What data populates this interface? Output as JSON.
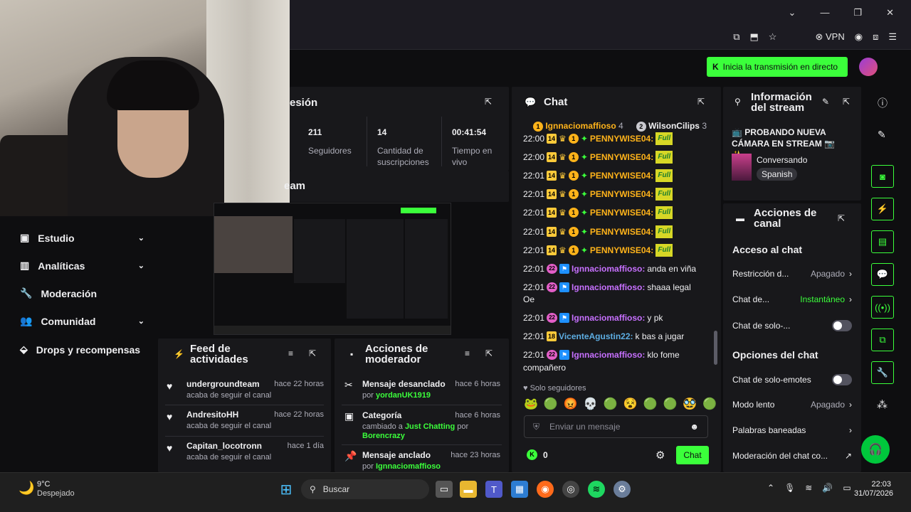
{
  "browser": {
    "vpn_label": "VPN"
  },
  "header": {
    "go_live": "Inicia la transmisión en directo"
  },
  "nav": [
    {
      "label": "Estudio",
      "expand": true
    },
    {
      "label": "Analíticas",
      "expand": true
    },
    {
      "label": "Moderación",
      "expand": false
    },
    {
      "label": "Comunidad",
      "expand": true
    },
    {
      "label": "Drops y recompensas",
      "expand": false
    }
  ],
  "stats": {
    "title": "esión",
    "items": [
      {
        "value": "211",
        "label": "Seguidores"
      },
      {
        "value": "14",
        "label": "Cantidad de suscripciones"
      },
      {
        "value": "00:41:54",
        "label": "Tiempo en vivo"
      }
    ]
  },
  "team": {
    "title": "eam"
  },
  "feed": {
    "title": "Feed de actividades",
    "items": [
      {
        "name": "undergroundteam",
        "sub": "acaba de seguir el canal",
        "time": "hace 22 horas"
      },
      {
        "name": "AndresitoHH",
        "sub": "acaba de seguir el canal",
        "time": "hace 22 horas"
      },
      {
        "name": "Capitan_locotronn",
        "sub": "acaba de seguir el canal",
        "time": "hace 1 día"
      }
    ]
  },
  "mod": {
    "title": "Acciones de moderador",
    "items": [
      {
        "title": "Mensaje desanclado",
        "pre": "por ",
        "user": "yordanUK1919",
        "mid": "",
        "user2": "",
        "time": "hace 6 horas"
      },
      {
        "title": "Categoría",
        "pre": "cambiado a ",
        "user": "Just Chatting",
        "mid": " por ",
        "user2": "Borencrazy",
        "time": "hace 6 horas"
      },
      {
        "title": "Mensaje anclado",
        "pre": "por ",
        "user": "Ignnaciomaffioso",
        "mid": "",
        "user2": "",
        "time": "hace 23 horas"
      }
    ]
  },
  "chat": {
    "title": "Chat",
    "top_chatters": [
      {
        "rank": "1",
        "name": "Ignnaciomaffioso",
        "count": "4"
      },
      {
        "rank": "2",
        "name": "WilsonCilips",
        "count": "3"
      }
    ],
    "pennywise_lines": [
      {
        "time": "22:00",
        "sub": "14",
        "name": "PENNYWISE04:",
        "emote": "Full"
      },
      {
        "time": "22:00",
        "sub": "14",
        "name": "PENNYWISE04:",
        "emote": "Full"
      },
      {
        "time": "22:01",
        "sub": "14",
        "name": "PENNYWISE04:",
        "emote": "Full"
      },
      {
        "time": "22:01",
        "sub": "14",
        "name": "PENNYWISE04:",
        "emote": "Full"
      },
      {
        "time": "22:01",
        "sub": "14",
        "name": "PENNYWISE04:",
        "emote": "Full"
      },
      {
        "time": "22:01",
        "sub": "14",
        "name": "PENNYWISE04:",
        "emote": "Full"
      },
      {
        "time": "22:01",
        "sub": "14",
        "name": "PENNYWISE04:",
        "emote": "Full"
      }
    ],
    "messages": [
      {
        "time": "22:01",
        "badge": "22",
        "name": "Ignnaciomaffioso:",
        "text": " anda en viña"
      },
      {
        "time": "22:01",
        "badge": "22",
        "name": "Ignnaciomaffioso:",
        "text": " shaaa legal",
        "cont": "Oe"
      },
      {
        "time": "22:01",
        "badge": "22",
        "name": "Ignnaciomaffioso:",
        "text": " y pk"
      },
      {
        "time": "22:01",
        "badge": "18",
        "name": "VicenteAgustin22:",
        "text": " k bas a jugar"
      },
      {
        "time": "22:01",
        "badge": "22",
        "name": "Ignnaciomaffioso:",
        "text": " klo fome",
        "cont": "compañero"
      }
    ],
    "followers_only": "Solo seguidores",
    "placeholder": "Enviar un mensaje",
    "points": "0",
    "send": "Chat"
  },
  "info": {
    "title": "Información del stream",
    "stream_title": "📺 PROBANDO NUEVA CÁMARA EN STREAM 📷 ✨...",
    "category": "Conversando",
    "tag": "Spanish"
  },
  "actions": {
    "title": "Acciones de canal",
    "access_title": "Acceso al chat",
    "restriction": {
      "label": "Restricción d...",
      "value": "Apagado"
    },
    "delay": {
      "label": "Chat de...",
      "value": "Instantáneo"
    },
    "subs_only": {
      "label": "Chat de solo-..."
    },
    "options_title": "Opciones del chat",
    "emotes_only": {
      "label": "Chat de solo-emotes"
    },
    "slow": {
      "label": "Modo lento",
      "value": "Apagado"
    },
    "banned": {
      "label": "Palabras baneadas"
    },
    "automod": {
      "label": "Moderación del chat co..."
    }
  },
  "taskbar": {
    "temp": "9°C",
    "weather": "Despejado",
    "search": "Buscar",
    "time": "22:03",
    "date": "31/07/2026"
  },
  "colors": {
    "accent": "#3bff3b",
    "panel": "#18181b",
    "bg": "#0e0e10"
  }
}
